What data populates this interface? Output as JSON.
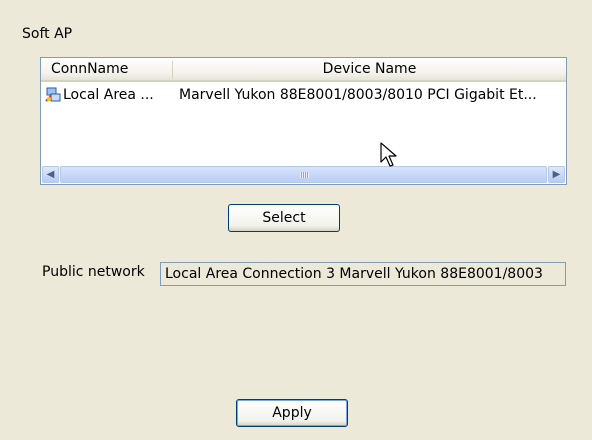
{
  "section": {
    "label": "Soft AP"
  },
  "list": {
    "columns": [
      "ConnName",
      "Device Name"
    ],
    "rows": [
      {
        "conn": "Local Area ...",
        "device": "Marvell Yukon 88E8001/8003/8010 PCI Gigabit Et..."
      }
    ],
    "scroll_grip": "|||"
  },
  "buttons": {
    "select": "Select",
    "apply": "Apply"
  },
  "public_network": {
    "label": "Public network",
    "value": "Local Area Connection 3 Marvell Yukon 88E8001/8003"
  },
  "icons": [
    "network-connection-icon",
    "scroll-left-icon",
    "scroll-right-icon",
    "mouse-cursor-icon"
  ],
  "colors": {
    "background": "#ece9d8",
    "border": "#7f9db9",
    "button_border": "#003c74"
  }
}
